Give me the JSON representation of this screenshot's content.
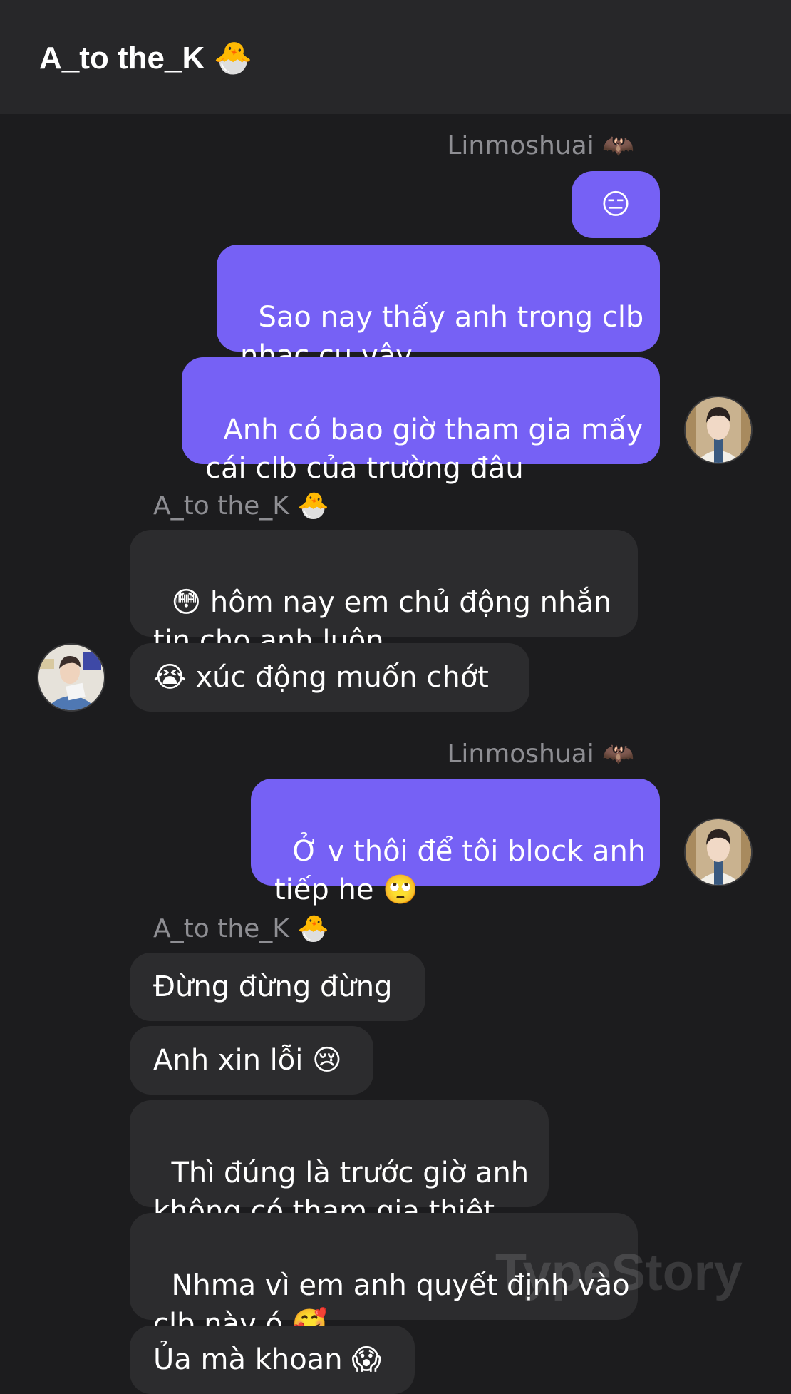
{
  "header": {
    "title": "A_to the_K 🐣"
  },
  "watermark": "TypeStory",
  "messages": {
    "g1": {
      "sender": "Linmoshuai 🦇",
      "m1": "😑",
      "m2": "Sao nay thấy anh trong clb\nnhạc cụ vậy",
      "m3": "Anh có bao giờ tham gia mấy\ncái clb của trường đâu"
    },
    "g2": {
      "sender": "A_to the_K 🐣",
      "m1": "😳 hôm nay em chủ động nhắn\ntin cho anh luôn",
      "m2": "😭 xúc động muốn chớt"
    },
    "g3": {
      "sender": "Linmoshuai 🦇",
      "m1": "Ở v thôi để tôi block anh\ntiếp he 🙄"
    },
    "g4": {
      "sender": "A_to the_K 🐣",
      "m1": "Đừng đừng đừng",
      "m2": "Anh xin lỗi 😢",
      "m3": "Thì đúng là trước giờ anh\nkhông có tham gia thiệt",
      "m4": "Nhma vì em anh quyết định vào\nclb này ó 🥰",
      "m5": "Ủa mà khoan 😱"
    }
  },
  "colors": {
    "background": "#1c1c1e",
    "header": "#272729",
    "outgoing_bubble": "#7661f5",
    "incoming_bubble": "#2c2c2e",
    "sender_label": "#8e8e93"
  },
  "avatars": {
    "linmoshuai": "avatar-linmoshuai",
    "a_to_the_k": "avatar-a-to-the-k"
  }
}
